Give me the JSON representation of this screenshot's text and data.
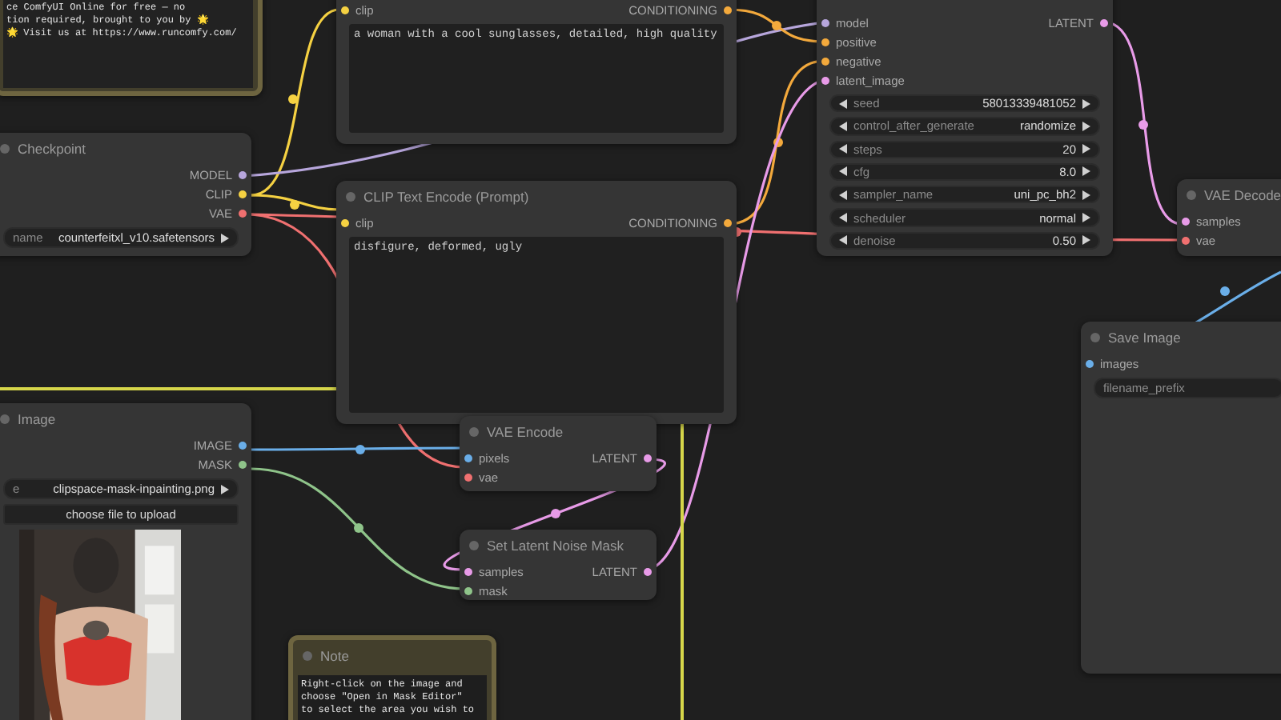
{
  "nodes": [
    {
      "kind": "note",
      "text": "ce ComfyUI Online for free — no\ntion required, brought to you by 🌟\n🌟 Visit us at https://www.runcomfy.com/"
    },
    {
      "kind": "node",
      "title": "Checkpoint",
      "outputs": [
        {
          "name": "MODEL",
          "kind": "MODEL"
        },
        {
          "name": "CLIP",
          "kind": "CLIP"
        },
        {
          "name": "VAE",
          "kind": "VAE"
        }
      ],
      "widgets": [
        {
          "kind": "combo",
          "label": "name",
          "value": "counterfeitxl_v10.safetensors"
        }
      ]
    },
    {
      "kind": "node",
      "inputs": [
        {
          "name": "clip",
          "kind": "CLIP"
        }
      ],
      "outputs": [
        {
          "name": "CONDITIONING",
          "kind": "CONDITIONING"
        }
      ],
      "widgets": [
        {
          "kind": "textarea",
          "value": "a woman with a cool sunglasses, detailed, high quality"
        }
      ]
    },
    {
      "kind": "node",
      "title": "CLIP Text Encode (Prompt)",
      "inputs": [
        {
          "name": "clip",
          "kind": "CLIP"
        }
      ],
      "outputs": [
        {
          "name": "CONDITIONING",
          "kind": "CONDITIONING"
        }
      ],
      "widgets": [
        {
          "kind": "textarea",
          "value": "disfigure, deformed, ugly"
        }
      ]
    },
    {
      "kind": "node",
      "inputs": [
        {
          "name": "model",
          "kind": "MODEL"
        },
        {
          "name": "positive",
          "kind": "CONDITIONING"
        },
        {
          "name": "negative",
          "kind": "CONDITIONING"
        },
        {
          "name": "latent_image",
          "kind": "LATENT"
        }
      ],
      "outputs": [
        {
          "name": "LATENT",
          "kind": "LATENT"
        }
      ],
      "widgets": [
        {
          "kind": "number",
          "label": "seed",
          "value": "58013339481052"
        },
        {
          "kind": "number",
          "label": "control_after_generate",
          "value": "randomize"
        },
        {
          "kind": "number",
          "label": "steps",
          "value": "20"
        },
        {
          "kind": "number",
          "label": "cfg",
          "value": "8.0"
        },
        {
          "kind": "number",
          "label": "sampler_name",
          "value": "uni_pc_bh2"
        },
        {
          "kind": "number",
          "label": "scheduler",
          "value": "normal"
        },
        {
          "kind": "number",
          "label": "denoise",
          "value": "0.50"
        }
      ]
    },
    {
      "kind": "node",
      "title": "VAE Decode",
      "inputs": [
        {
          "name": "samples",
          "kind": "LATENT"
        },
        {
          "name": "vae",
          "kind": "VAE"
        }
      ]
    },
    {
      "kind": "node",
      "title": "Save Image",
      "inputs": [
        {
          "name": "images",
          "kind": "IMAGE"
        }
      ],
      "widgets": [
        {
          "kind": "text",
          "label": "filename_prefix"
        }
      ]
    },
    {
      "kind": "node",
      "title": "Image",
      "outputs": [
        {
          "name": "IMAGE",
          "kind": "IMAGE"
        },
        {
          "name": "MASK",
          "kind": "MASK"
        }
      ],
      "widgets": [
        {
          "kind": "combo",
          "label": "e",
          "value": "clipspace-mask-inpainting.png"
        },
        {
          "kind": "button",
          "label": "choose file to upload"
        },
        {
          "kind": "picture"
        }
      ]
    },
    {
      "kind": "node",
      "title": "VAE Encode",
      "inputs": [
        {
          "name": "pixels",
          "kind": "IMAGE"
        },
        {
          "name": "vae",
          "kind": "VAE"
        }
      ],
      "outputs": [
        {
          "name": "LATENT",
          "kind": "LATENT"
        }
      ]
    },
    {
      "kind": "node",
      "title": "Set Latent Noise Mask",
      "inputs": [
        {
          "name": "samples",
          "kind": "LATENT"
        },
        {
          "name": "mask",
          "kind": "MASK"
        }
      ],
      "outputs": [
        {
          "name": "LATENT",
          "kind": "LATENT"
        }
      ]
    },
    {
      "kind": "note",
      "title": "Note",
      "text": "Right-click on the image and\nchoose \"Open in Mask Editor\"\nto select the area you wish to"
    }
  ],
  "links": [
    {
      "kind": "CLIP"
    },
    {
      "kind": "CLIP"
    },
    {
      "kind": "MODEL"
    },
    {
      "kind": "VAE"
    },
    {
      "kind": "VAE"
    },
    {
      "kind": "CONDITIONING"
    },
    {
      "kind": "CONDITIONING"
    },
    {
      "kind": "LATENT"
    },
    {
      "kind": "LATENT"
    },
    {
      "kind": "LATENT"
    },
    {
      "kind": "IMAGE"
    },
    {
      "kind": "MASK"
    },
    {
      "kind": "IMAGE"
    }
  ]
}
